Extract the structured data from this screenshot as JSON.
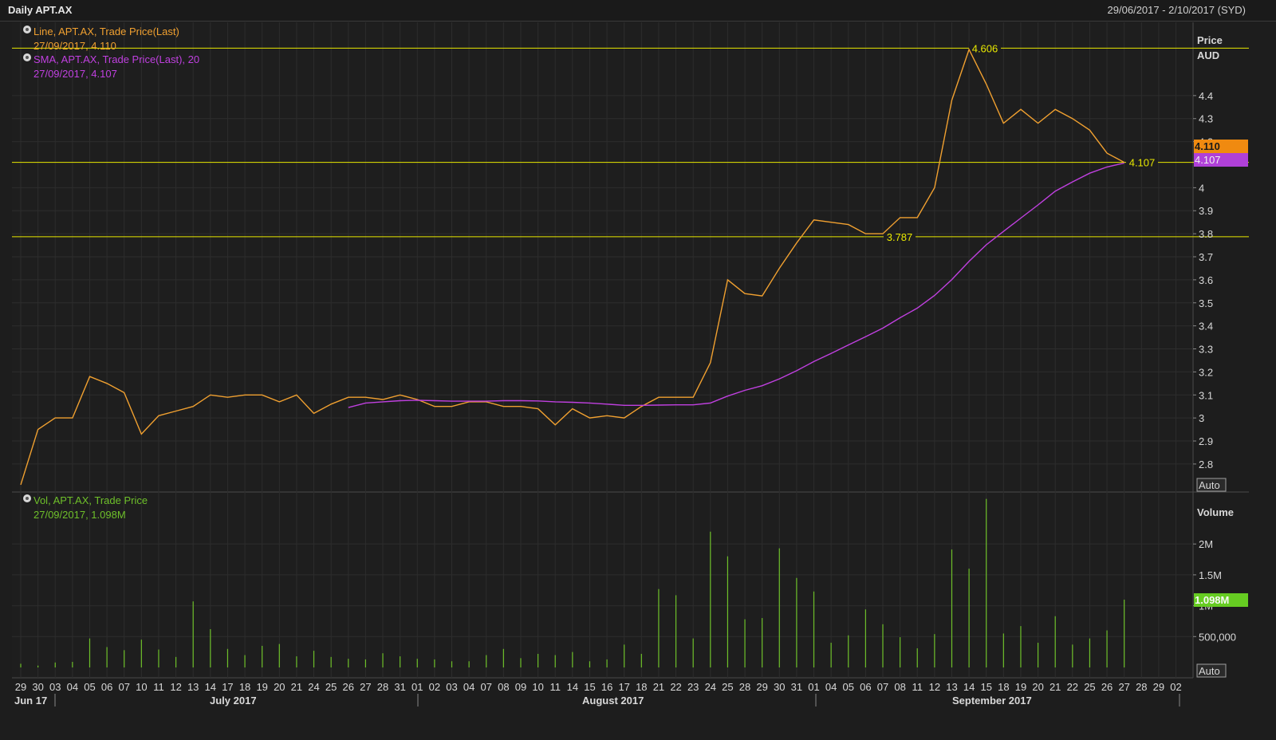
{
  "header": {
    "title": "Daily APT.AX",
    "date_range": "29/06/2017 - 2/10/2017 (SYD)"
  },
  "colors": {
    "price_line": "#f0a030",
    "sma_line": "#c040e0",
    "volume_bar": "#6ec02a",
    "reference_line": "#e8e800",
    "background": "#1e1e1e",
    "grid": "#2d2d2d"
  },
  "legend": {
    "price_name": "Line, APT.AX, Trade Price(Last)",
    "price_value": "27/09/2017, 4.110",
    "sma_name": "SMA, APT.AX, Trade Price(Last),  20",
    "sma_value": "27/09/2017, 4.107",
    "volume_name": "Vol, APT.AX, Trade Price",
    "volume_value": "27/09/2017, 1.098M"
  },
  "price_axis": {
    "title_line1": "Price",
    "title_line2": "AUD",
    "auto_label": "Auto",
    "last_price_badge": "4.110",
    "last_sma_badge": "4.107"
  },
  "volume_axis": {
    "title": "Volume",
    "auto_label": "Auto",
    "last_volume_badge": "1.098M"
  },
  "reference_lines": [
    {
      "value": 4.606,
      "label": "4.606"
    },
    {
      "value": 4.11,
      "label": "4.107"
    },
    {
      "value": 3.787,
      "label": "3.787"
    }
  ],
  "chart_data": [
    {
      "type": "line",
      "title": "Daily APT.AX",
      "ylabel": "Price AUD",
      "ylim": [
        2.72,
        4.68
      ],
      "yticks": [
        2.8,
        2.9,
        3,
        3.1,
        3.2,
        3.3,
        3.4,
        3.5,
        3.6,
        3.7,
        3.8,
        3.9,
        4,
        4.2,
        4.3,
        4.4
      ],
      "ytick_labels": [
        "2.8",
        "2.9",
        "3",
        "3.1",
        "3.2",
        "3.3",
        "3.4",
        "3.5",
        "3.6",
        "3.7",
        "3.8",
        "3.9",
        "4",
        "4.2",
        "4.3",
        "4.4"
      ],
      "x": [
        "29",
        "30",
        "03",
        "04",
        "05",
        "06",
        "07",
        "10",
        "11",
        "12",
        "13",
        "14",
        "17",
        "18",
        "19",
        "20",
        "21",
        "24",
        "25",
        "26",
        "27",
        "28",
        "31",
        "01",
        "02",
        "03",
        "04",
        "07",
        "08",
        "09",
        "10",
        "11",
        "14",
        "15",
        "16",
        "17",
        "18",
        "21",
        "22",
        "23",
        "24",
        "25",
        "28",
        "29",
        "30",
        "31",
        "01",
        "04",
        "05",
        "06",
        "07",
        "08",
        "11",
        "12",
        "13",
        "14",
        "15",
        "18",
        "19",
        "20",
        "21",
        "22",
        "25",
        "26",
        "27",
        "28",
        "29",
        "02"
      ],
      "month_labels": [
        "Jun 17",
        "July 2017",
        "August 2017",
        "September 2017"
      ],
      "series": [
        {
          "name": "Line, APT.AX, Trade Price(Last)",
          "values": [
            2.71,
            2.95,
            3.0,
            3.0,
            3.18,
            3.15,
            3.11,
            2.93,
            3.01,
            3.03,
            3.05,
            3.1,
            3.09,
            3.1,
            3.1,
            3.07,
            3.1,
            3.02,
            3.06,
            3.09,
            3.09,
            3.08,
            3.1,
            3.08,
            3.05,
            3.05,
            3.07,
            3.07,
            3.05,
            3.05,
            3.04,
            2.97,
            3.04,
            3.0,
            3.01,
            3.0,
            3.05,
            3.09,
            3.09,
            3.09,
            3.24,
            3.6,
            3.54,
            3.53,
            3.65,
            3.76,
            3.86,
            3.85,
            3.84,
            3.8,
            3.8,
            3.87,
            3.87,
            4.0,
            4.38,
            4.6,
            4.45,
            4.28,
            4.34,
            4.28,
            4.34,
            4.3,
            4.25,
            4.15,
            4.11
          ]
        },
        {
          "name": "SMA, APT.AX, Trade Price(Last),  20",
          "values": [
            null,
            null,
            null,
            null,
            null,
            null,
            null,
            null,
            null,
            null,
            null,
            null,
            null,
            null,
            null,
            null,
            null,
            null,
            null,
            3.045,
            3.065,
            3.07,
            3.075,
            3.077,
            3.075,
            3.073,
            3.073,
            3.073,
            3.075,
            3.075,
            3.074,
            3.07,
            3.068,
            3.065,
            3.06,
            3.055,
            3.055,
            3.056,
            3.057,
            3.057,
            3.065,
            3.095,
            3.12,
            3.14,
            3.17,
            3.205,
            3.245,
            3.28,
            3.317,
            3.353,
            3.39,
            3.435,
            3.477,
            3.532,
            3.601,
            3.68,
            3.752,
            3.81,
            3.868,
            3.925,
            3.985,
            4.025,
            4.063,
            4.09,
            4.107
          ]
        }
      ]
    },
    {
      "type": "bar",
      "title": "Vol, APT.AX, Trade Price",
      "ylabel": "Volume",
      "ylim": [
        0,
        2700000
      ],
      "yticks": [
        500000,
        1000000,
        1500000,
        2000000
      ],
      "ytick_labels": [
        "500,000",
        "1M",
        "1.5M",
        "2M"
      ],
      "values": [
        60000,
        30000,
        80000,
        90000,
        470000,
        330000,
        280000,
        450000,
        290000,
        170000,
        1070000,
        620000,
        300000,
        200000,
        350000,
        380000,
        180000,
        270000,
        170000,
        140000,
        130000,
        230000,
        180000,
        140000,
        130000,
        100000,
        100000,
        200000,
        300000,
        150000,
        220000,
        200000,
        250000,
        100000,
        130000,
        370000,
        220000,
        1270000,
        1170000,
        470000,
        2200000,
        1800000,
        780000,
        800000,
        1930000,
        1450000,
        1230000,
        400000,
        520000,
        940000,
        700000,
        490000,
        310000,
        540000,
        1910000,
        1600000,
        2730000,
        550000,
        670000,
        400000,
        830000,
        370000,
        470000,
        600000,
        1098000
      ]
    }
  ]
}
